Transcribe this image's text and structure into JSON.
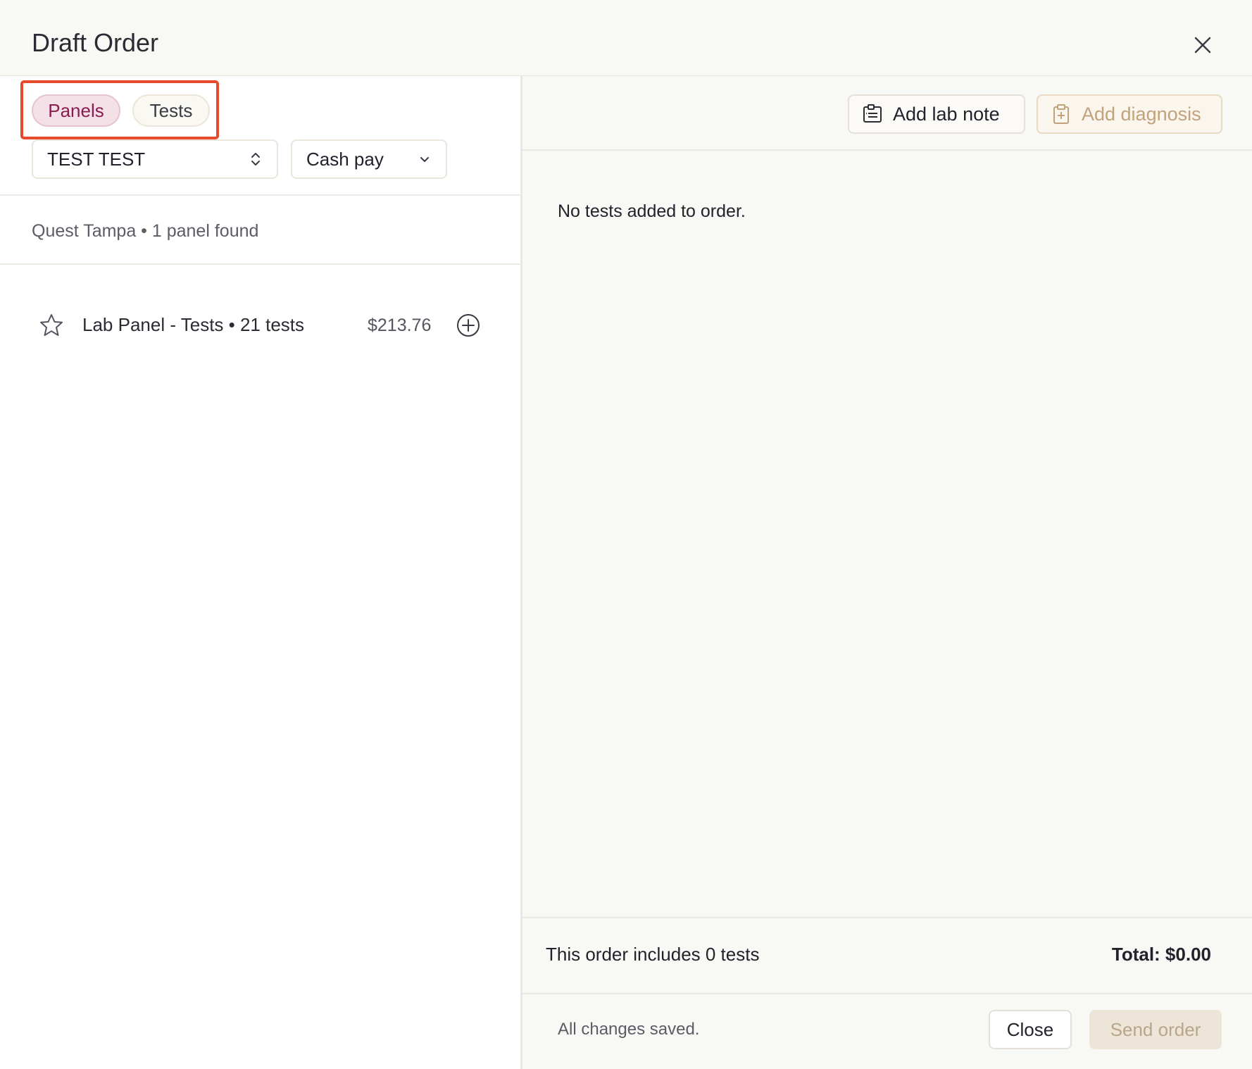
{
  "header": {
    "title": "Draft Order"
  },
  "left": {
    "tabs": [
      {
        "label": "Panels",
        "active": true
      },
      {
        "label": "Tests",
        "active": false
      }
    ],
    "patient_select": {
      "value": "TEST TEST"
    },
    "payment_select": {
      "value": "Cash pay"
    },
    "summary": "Quest Tampa • 1 panel found",
    "panels": [
      {
        "name": "Lab Panel - Tests • 21 tests",
        "price": "$213.76"
      }
    ]
  },
  "right": {
    "toolbar": {
      "add_lab_note": "Add lab note",
      "add_diagnosis": "Add diagnosis"
    },
    "empty_message": "No tests added to order.",
    "includes": "This order includes 0 tests",
    "total": "Total: $0.00",
    "saved_status": "All changes saved.",
    "close_label": "Close",
    "send_label": "Send order"
  },
  "colors": {
    "accent_active": "#8a1d50",
    "highlight_box": "#e84a2d",
    "disabled_text": "#c2a27a"
  }
}
